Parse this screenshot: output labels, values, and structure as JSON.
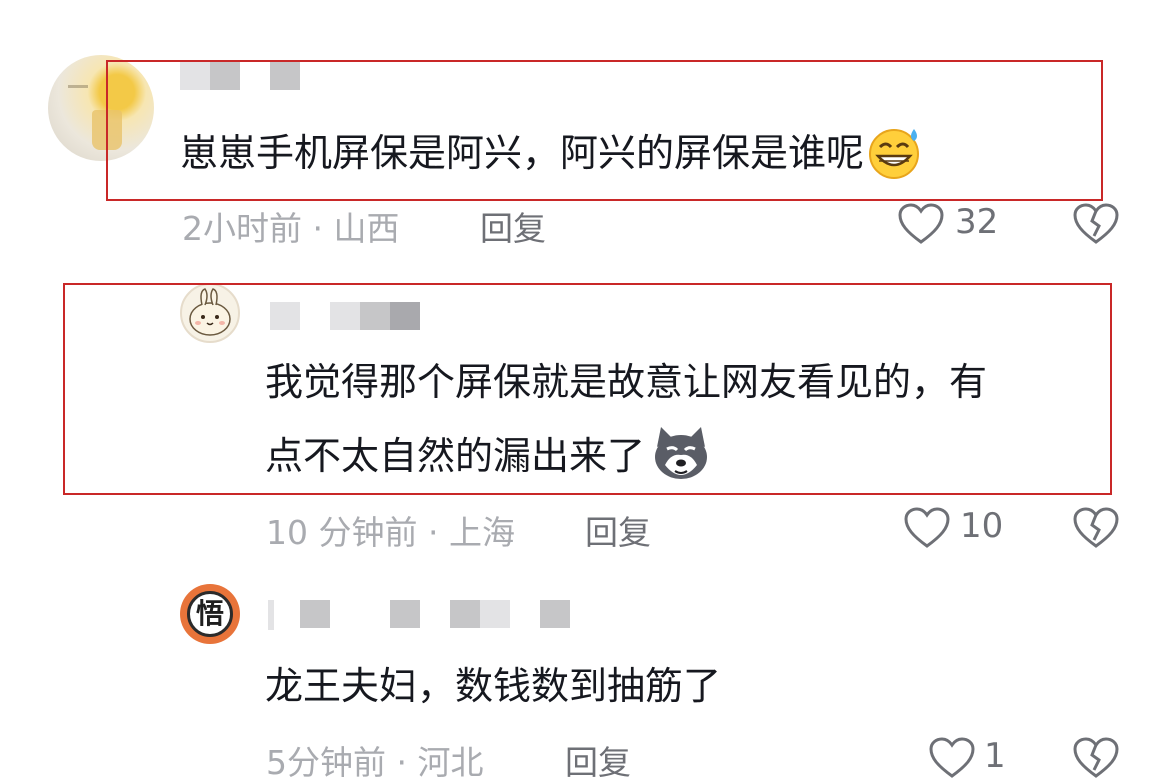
{
  "comments": [
    {
      "text": "崽崽手机屏保是阿兴，阿兴的屏保是谁呢",
      "emoji": "grinning-sweat-emoji",
      "meta": "2小时前 · 山西",
      "reply": "回复",
      "likes": "32"
    },
    {
      "text_line1": "我觉得那个屏保就是故意让网友看见的，有",
      "text_line2": "点不太自然的漏出来了",
      "emoji": "husky-dog-emoji",
      "meta": "10 分钟前 · 上海",
      "reply": "回复",
      "likes": "10"
    },
    {
      "avatar_char": "悟",
      "text": "龙王夫妇，数钱数到抽筋了",
      "meta": "5分钟前 · 河北",
      "reply": "回复",
      "likes": "1"
    }
  ],
  "colors": {
    "highlight_border": "#c92828",
    "meta_text": "#a9abb0",
    "action_text": "#6e7076",
    "avatar3_bg": "#e8743a"
  }
}
